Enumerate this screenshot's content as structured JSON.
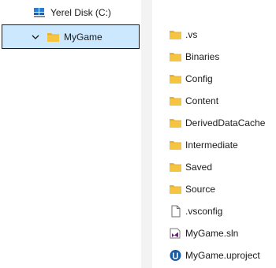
{
  "sidebar": {
    "disk": {
      "label": "Yerel Disk (C:)",
      "icon": "hard-drive-icon"
    },
    "selected": {
      "label": "MyGame",
      "icon": "folder-icon",
      "expand_icon": "chevron-down-icon"
    }
  },
  "files": [
    {
      "name": ".vs",
      "icon": "folder-icon"
    },
    {
      "name": "Binaries",
      "icon": "folder-icon"
    },
    {
      "name": "Config",
      "icon": "folder-icon"
    },
    {
      "name": "Content",
      "icon": "folder-icon"
    },
    {
      "name": "DerivedDataCache",
      "icon": "folder-icon"
    },
    {
      "name": "Intermediate",
      "icon": "folder-icon"
    },
    {
      "name": "Saved",
      "icon": "folder-icon"
    },
    {
      "name": "Source",
      "icon": "folder-icon"
    },
    {
      "name": ".vsconfig",
      "icon": "document-icon"
    },
    {
      "name": "MyGame.sln",
      "icon": "visual-studio-solution-icon"
    },
    {
      "name": "MyGame.uproject",
      "icon": "unreal-project-icon"
    }
  ],
  "colors": {
    "selection_bg": "#cce8ff",
    "folder": "#f5c542",
    "divider": "#f3f3f3"
  }
}
